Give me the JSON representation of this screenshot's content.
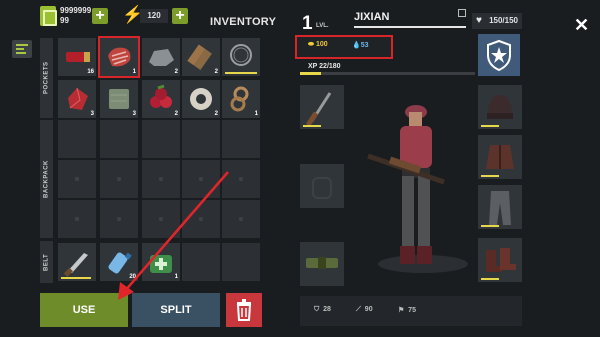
{
  "header": {
    "cash_line1": "9999999",
    "cash_line2": "99",
    "energy": "120",
    "title": "INVENTORY",
    "level_number": "1",
    "level_suffix": "LVL.",
    "player_name": "JIXIAN",
    "hp": "150/150"
  },
  "sections": {
    "pockets": "POCKETS",
    "backpack": "BACKPACK",
    "belt": "BELT"
  },
  "pockets_row1": [
    {
      "icon": "shotgun-shells-icon",
      "count": "16"
    },
    {
      "icon": "raw-meat-icon",
      "count": "1"
    },
    {
      "icon": "stone-icon",
      "count": "2"
    },
    {
      "icon": "wood-logs-icon",
      "count": "2"
    },
    {
      "icon": "barbed-wire-icon",
      "count": ""
    }
  ],
  "pockets_row2": [
    {
      "icon": "red-crystal-icon",
      "count": "3"
    },
    {
      "icon": "cloth-icon",
      "count": "3"
    },
    {
      "icon": "berries-icon",
      "count": "2"
    },
    {
      "icon": "duct-tape-icon",
      "count": "2"
    },
    {
      "icon": "rope-icon",
      "count": "1"
    }
  ],
  "belt": [
    {
      "icon": "knife-icon",
      "count": ""
    },
    {
      "icon": "water-bottle-icon",
      "count": "20"
    },
    {
      "icon": "first-aid-kit-icon",
      "count": "1"
    }
  ],
  "buttons": {
    "use": "USE",
    "split": "SPLIT"
  },
  "character": {
    "gold": "100",
    "water": "53",
    "xp": "XP 22/180",
    "xp_progress": 0.12
  },
  "stats": {
    "defense": "28",
    "attack": "90",
    "speed": "75"
  },
  "colors": {
    "accent_green": "#6e8c2a",
    "highlight_red": "#d7262a",
    "split_blue": "#3a5063",
    "trash_red": "#c8373c"
  }
}
